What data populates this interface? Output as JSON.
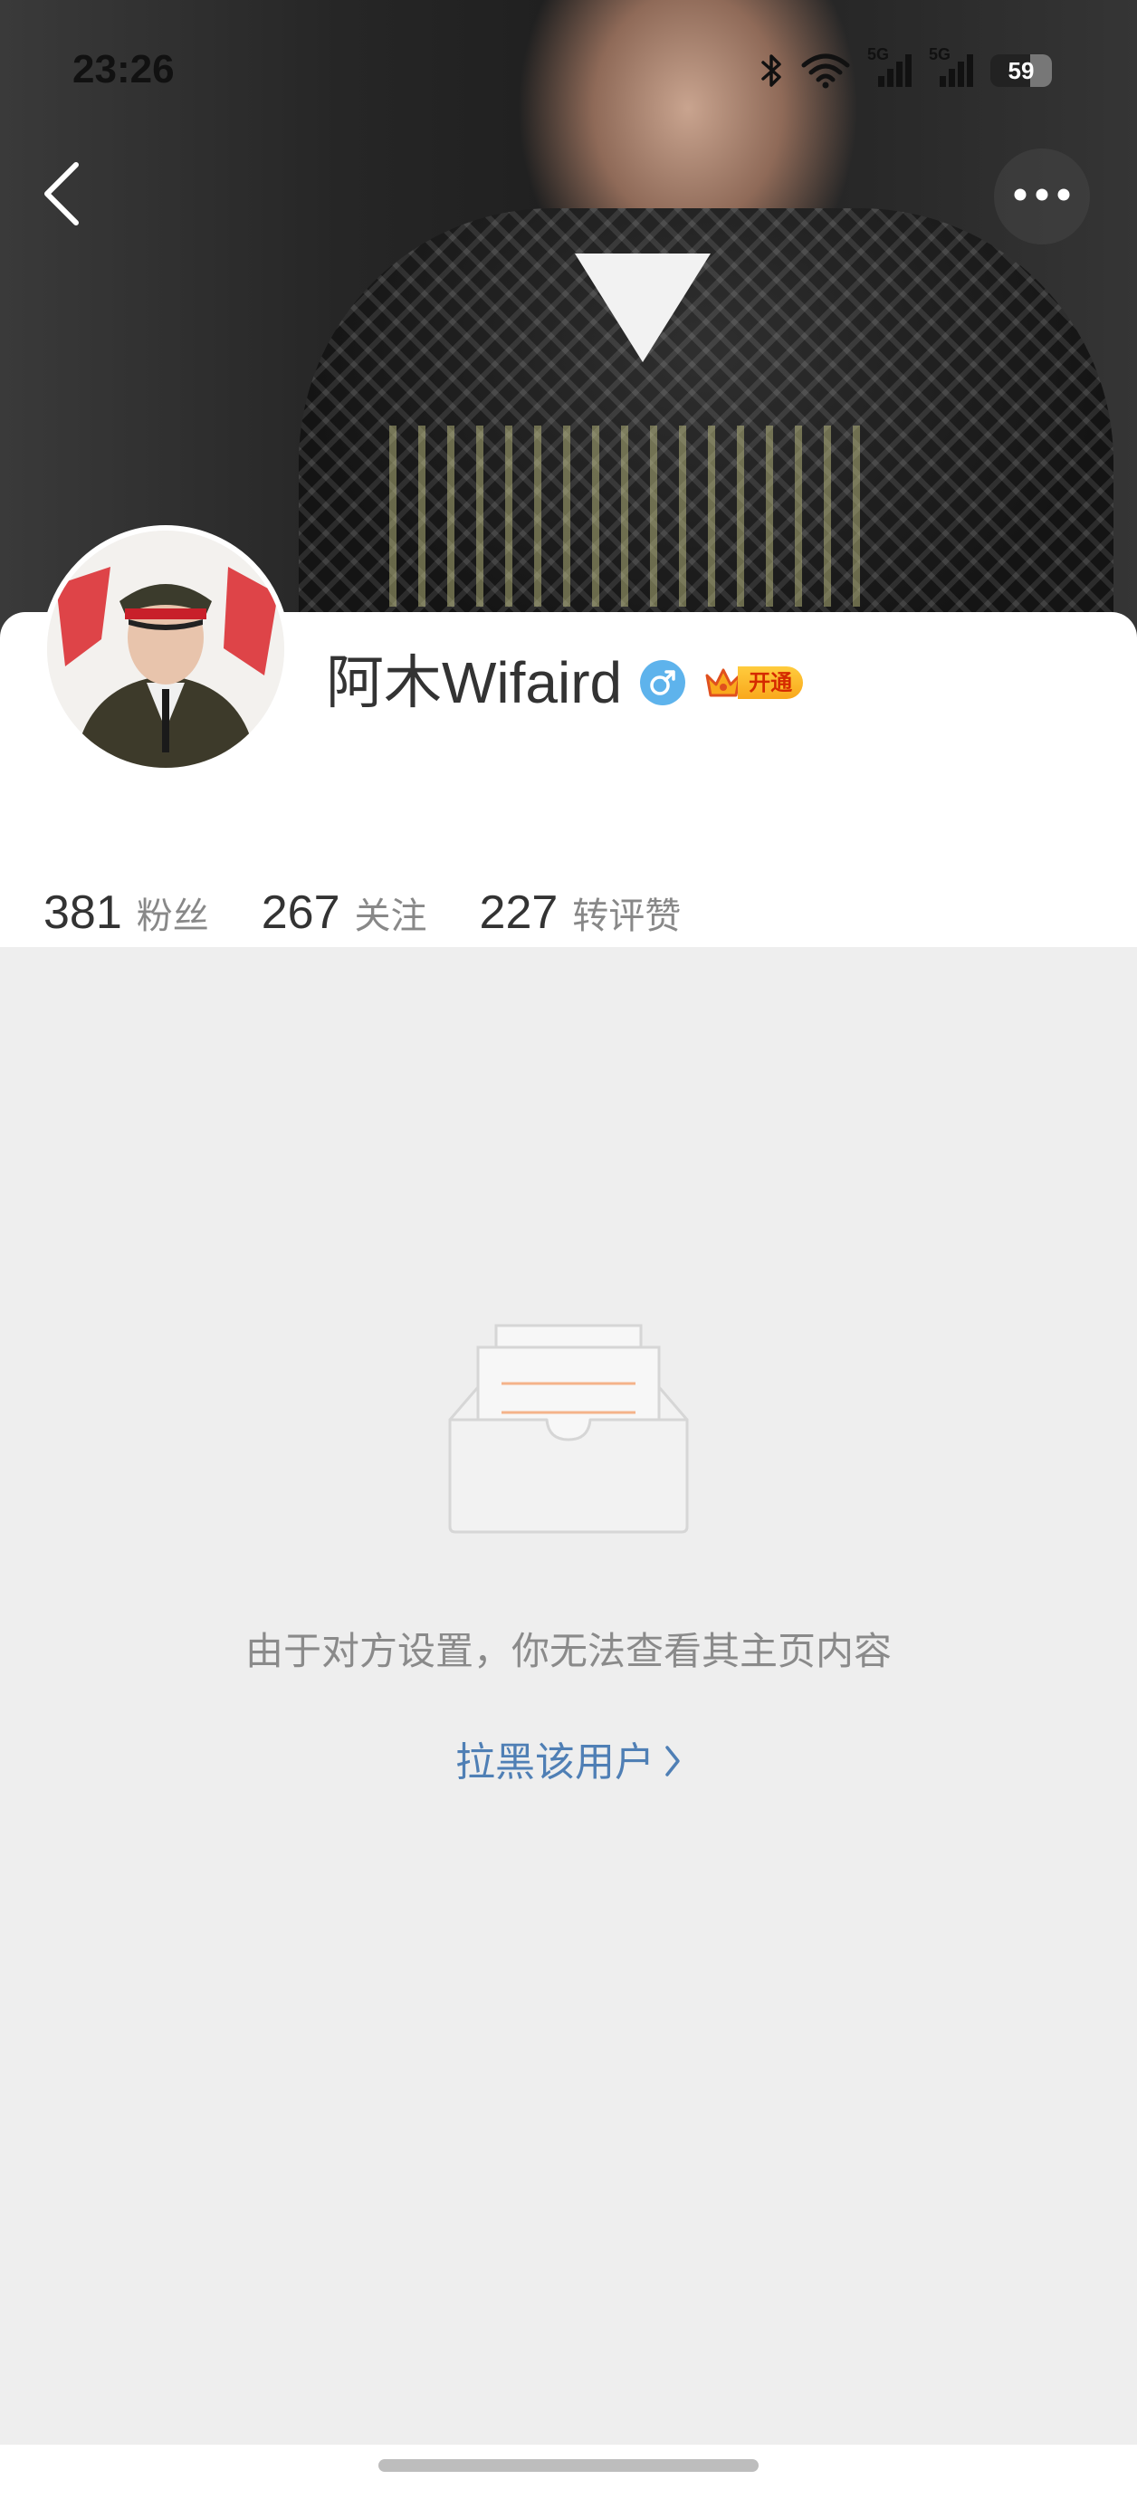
{
  "status_bar": {
    "time": "23:26",
    "network_1": "5G",
    "network_2": "5G",
    "battery": "59"
  },
  "nav": {
    "back_icon": "chevron-left-icon",
    "more_icon": "ellipsis-icon"
  },
  "profile": {
    "username": "阿木Wifaird",
    "gender_icon": "male-icon",
    "vip_label": "开通",
    "stats": [
      {
        "value": "381",
        "label": "粉丝"
      },
      {
        "value": "267",
        "label": "关注"
      },
      {
        "value": "227",
        "label": "转评赞"
      }
    ]
  },
  "empty_state": {
    "illustration_icon": "empty-inbox-icon",
    "message": "由于对方设置，你无法查看其主页内容",
    "block_link": "拉黑该用户"
  },
  "colors": {
    "link": "#4f7fb5",
    "gender_badge": "#5eb3ec",
    "vip_gold": "#f9a81c",
    "page_background": "#eeeeee"
  }
}
